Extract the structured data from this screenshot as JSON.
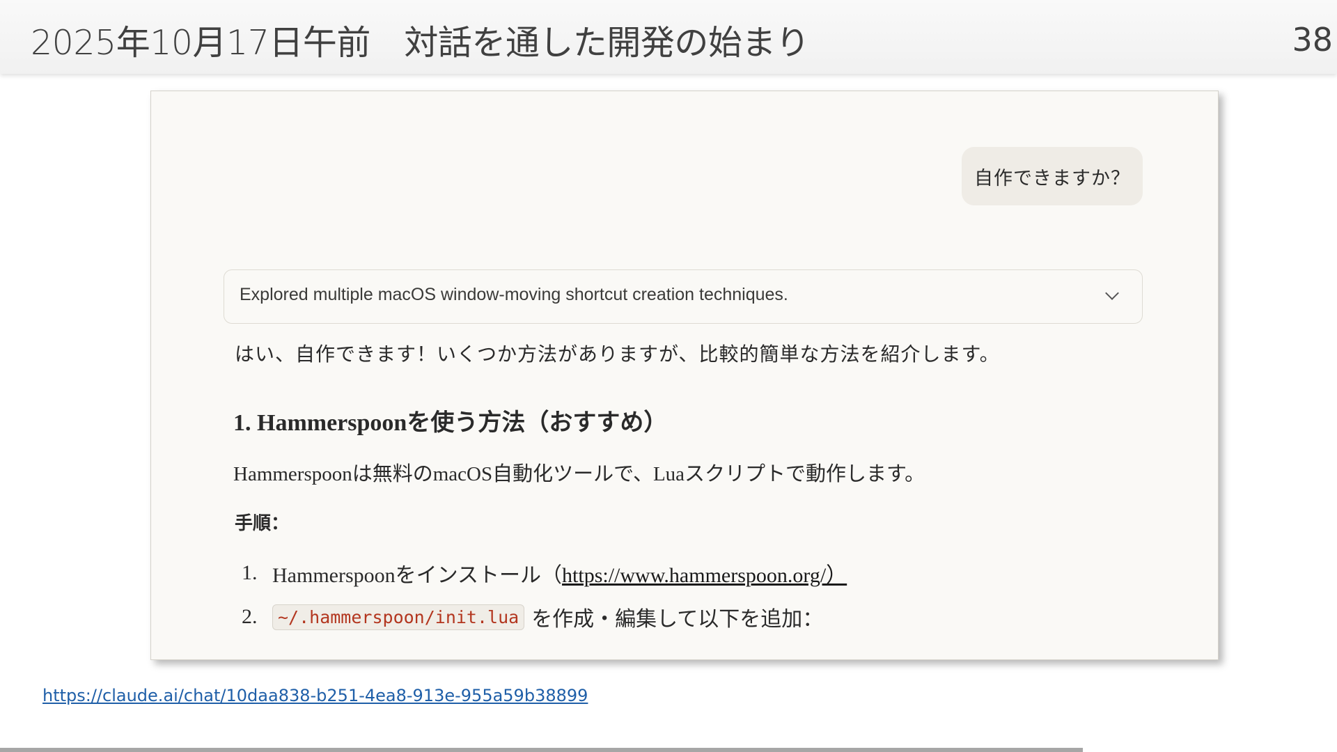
{
  "slide": {
    "title": "2025年10月17日午前　対話を通した開発の始まり",
    "page_number": "38",
    "progress_fraction": 0.81
  },
  "chat": {
    "user_message": "自作できますか？",
    "thinking_summary": "Explored multiple macOS window-moving shortcut creation techniques.",
    "intro": "はい、自作できます！いくつか方法がありますが、比較的簡単な方法を紹介します。",
    "heading": "1. Hammerspoonを使う方法（おすすめ）",
    "description": "Hammerspoonは無料のmacOS自動化ツールで、Luaスクリプトで動作します。",
    "steps_label": "手順：",
    "steps": [
      {
        "number": "1.",
        "text": "Hammerspoonをインストール（",
        "link": "https://www.hammerspoon.org/）",
        "suffix": ""
      },
      {
        "number": "2.",
        "code": "~/.hammerspoon/init.lua",
        "text": "を作成・編集して以下を追加："
      }
    ]
  },
  "source_link": "https://claude.ai/chat/10daa838-b251-4ea8-913e-955a59b38899",
  "icons": {
    "expand": "chevron-down-icon"
  }
}
